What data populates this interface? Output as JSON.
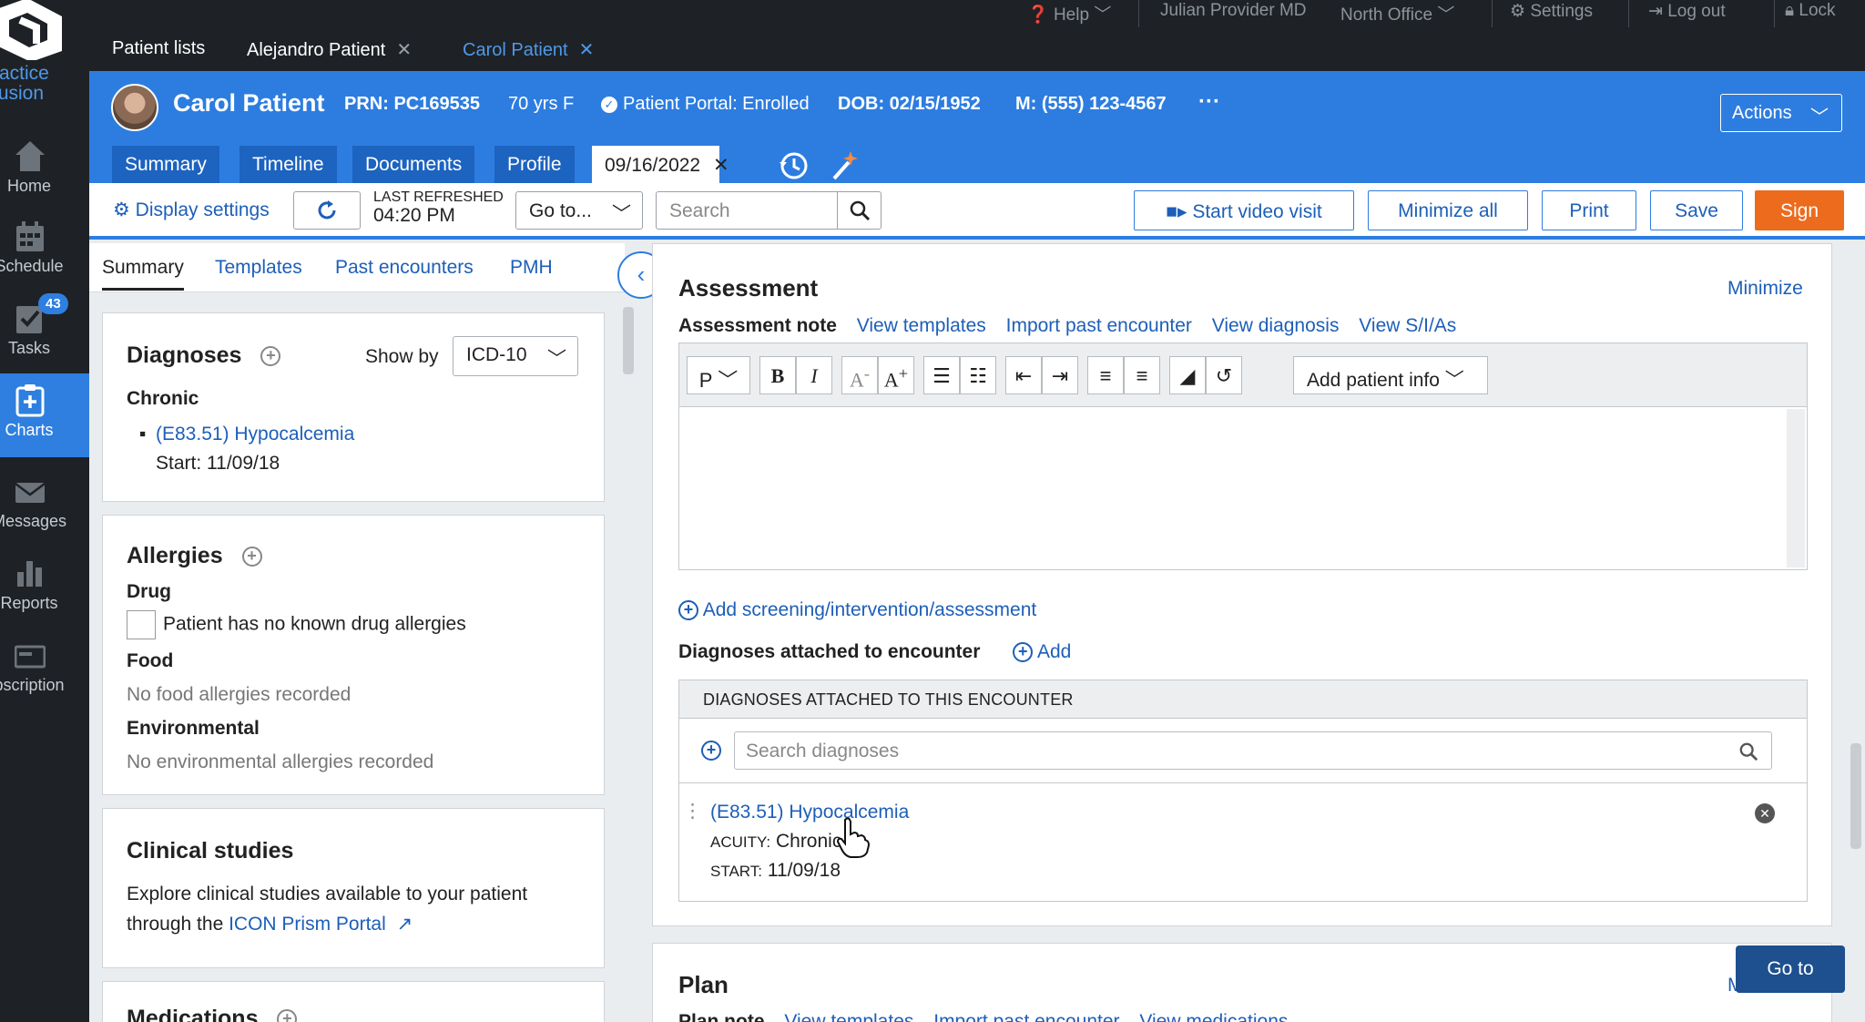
{
  "app": {
    "logo_text": "ractice\nfusion"
  },
  "sidebar": {
    "items": [
      {
        "label": "Home",
        "icon": "home-icon"
      },
      {
        "label": "Schedule",
        "icon": "calendar-icon"
      },
      {
        "label": "Tasks",
        "icon": "tasks-icon",
        "badge": "43"
      },
      {
        "label": "Charts",
        "icon": "charts-icon"
      },
      {
        "label": "Messages",
        "icon": "envelope-icon"
      },
      {
        "label": "Reports",
        "icon": "bar-chart-icon"
      },
      {
        "label": "bscription",
        "icon": "prescription-icon"
      }
    ]
  },
  "topbar": {
    "help": "Help",
    "user": "Julian Provider MD",
    "office": "North Office",
    "settings": "Settings",
    "logout": "Log out",
    "lock": "Lock"
  },
  "patient_tabs": [
    {
      "label": "Patient lists"
    },
    {
      "label": "Alejandro Patient"
    },
    {
      "label": "Carol Patient"
    }
  ],
  "patient": {
    "name": "Carol Patient",
    "prn": "PRN: PC169535",
    "age_sex": "70 yrs F",
    "portal": "Patient Portal: Enrolled",
    "dob": "DOB: 02/15/1952",
    "phone": "M: (555) 123-4567",
    "more": "···",
    "actions": "Actions"
  },
  "chart_tabs": [
    {
      "label": "Summary"
    },
    {
      "label": "Timeline"
    },
    {
      "label": "Documents"
    },
    {
      "label": "Profile"
    },
    {
      "label": "09/16/2022"
    }
  ],
  "toolbar": {
    "display_settings": "Display settings",
    "last_refreshed_label": "LAST REFRESHED",
    "last_refreshed_time": "04:20 PM",
    "goto": "Go to...",
    "search_placeholder": "Search",
    "start_video": "Start video visit",
    "minimize_all": "Minimize all",
    "print": "Print",
    "save": "Save",
    "sign": "Sign"
  },
  "left_tabs": [
    {
      "label": "Summary"
    },
    {
      "label": "Templates"
    },
    {
      "label": "Past encounters"
    },
    {
      "label": "PMH"
    }
  ],
  "diagnoses_card": {
    "title": "Diagnoses",
    "show_by_label": "Show by",
    "show_by_value": "ICD-10",
    "category": "Chronic",
    "item": "(E83.51) Hypocalcemia",
    "start": "Start: 11/09/18"
  },
  "allergies_card": {
    "title": "Allergies",
    "drug": "Drug",
    "nkda": "Patient has no known drug allergies",
    "food": "Food",
    "food_none": "No food allergies recorded",
    "env": "Environmental",
    "env_none": "No environmental allergies recorded"
  },
  "clinical_card": {
    "title": "Clinical studies",
    "line1": "Explore clinical studies available to your patient",
    "line2": "through the ",
    "link": "ICON Prism Portal"
  },
  "medications_card": {
    "title": "Medications"
  },
  "assessment": {
    "title": "Assessment",
    "minimize": "Minimize",
    "links": [
      "Assessment note",
      "View templates",
      "Import past encounter",
      "View diagnosis",
      "View S/I/As"
    ],
    "para": "P",
    "add_patient_info": "Add patient info",
    "add_screening": "Add screening/intervention/assessment",
    "diag_attached": "Diagnoses attached to encounter",
    "add": "Add",
    "table_header": "DIAGNOSES ATTACHED TO THIS ENCOUNTER",
    "search_placeholder": "Search diagnoses",
    "dx_link": "(E83.51) Hypocalcemia",
    "acuity_label": "ACUITY:",
    "acuity_value": "Chronic",
    "start_label": "START:",
    "start_value": "11/09/18"
  },
  "plan": {
    "title": "Plan",
    "minimize": "M",
    "links": [
      "Plan note",
      "View templates",
      "Import past encounter",
      "View medications"
    ]
  },
  "goto_button": "Go to",
  "colors": {
    "brand_blue": "#2d7de0",
    "dark": "#1e2226",
    "sign_orange": "#ed6b1d",
    "link": "#1d5fb8"
  }
}
